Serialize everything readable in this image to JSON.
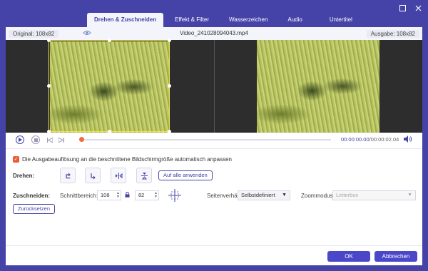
{
  "tabs": [
    {
      "label": "Drehen & Zuschneiden",
      "active": true
    },
    {
      "label": "Effekt & Filter",
      "active": false
    },
    {
      "label": "Wasserzeichen",
      "active": false
    },
    {
      "label": "Audio",
      "active": false
    },
    {
      "label": "Untertitel",
      "active": false
    }
  ],
  "window": {
    "minimize_icon": "minimize-icon",
    "close_icon": "close-icon"
  },
  "info": {
    "original_label": "Original: 108x82",
    "filename": "Video_241028094043.mp4",
    "output_label": "Ausgabe: 108x82"
  },
  "transport": {
    "current_time": "00:00:00.00",
    "duration": "/00:00:02.04",
    "progress": 0
  },
  "auto_fit": {
    "checked": true,
    "label": "Die Ausgabeauflösung an die beschnittene Bildschirmgröße automatisch anpassen"
  },
  "rotate": {
    "label": "Drehen:",
    "apply_all": "Auf alle anwenden"
  },
  "crop": {
    "label": "Zuschneiden:",
    "area_label": "Schnittbereich:",
    "width": "108",
    "height": "82",
    "aspect_label": "Seitenverhältnis:",
    "aspect_value": "Selbstdefiniert",
    "zoom_label": "Zoommodus:",
    "zoom_value": "Letterbox",
    "reset": "Zurücksetzen"
  },
  "footer": {
    "ok": "OK",
    "cancel": "Abbrechen"
  },
  "colors": {
    "accent": "#4543a8",
    "checkbox": "#f05a33",
    "crop_border": "#f3e24a",
    "playhead": "#f26b3a"
  }
}
